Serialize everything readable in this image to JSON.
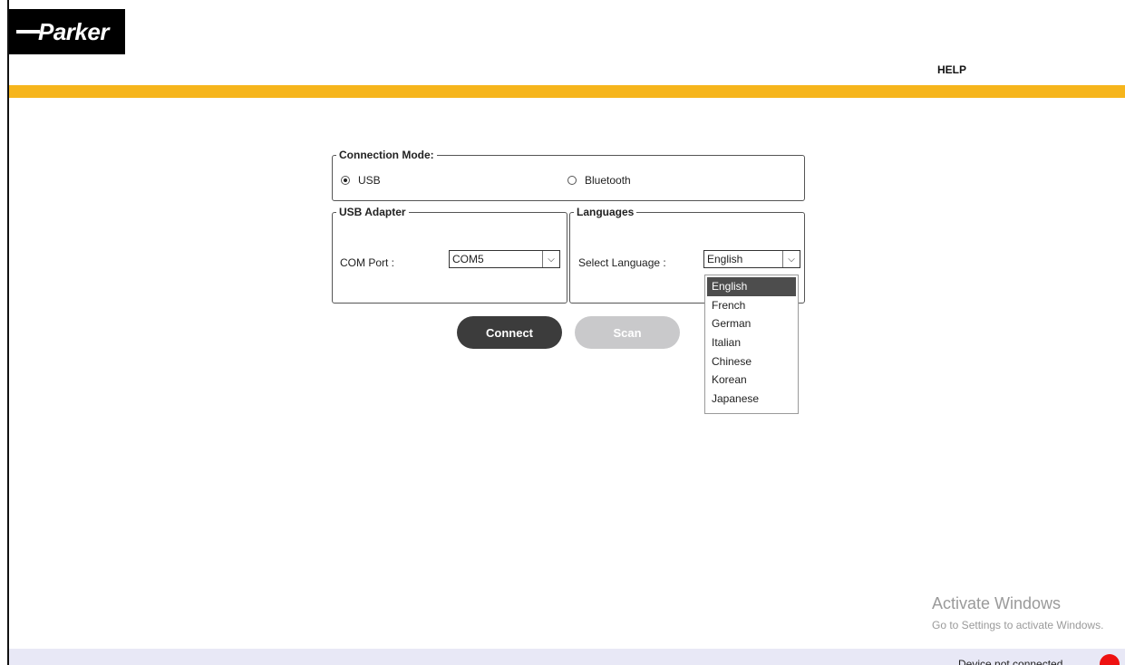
{
  "brand": {
    "logo_text": "Parker"
  },
  "header": {
    "help_label": "HELP"
  },
  "connection_mode": {
    "legend": "Connection Mode:",
    "options": [
      {
        "label": "USB",
        "selected": true
      },
      {
        "label": "Bluetooth",
        "selected": false
      }
    ]
  },
  "usb_adapter": {
    "legend": "USB Adapter",
    "com_port_label": "COM Port :",
    "com_port_value": "COM5"
  },
  "languages": {
    "legend": "Languages",
    "select_label": "Select Language :",
    "selected_value": "English",
    "options": [
      "English",
      "French",
      "German",
      "Italian",
      "Chinese",
      "Korean",
      "Japanese"
    ]
  },
  "actions": {
    "connect_label": "Connect",
    "scan_label": "Scan"
  },
  "watermark": {
    "title": "Activate Windows",
    "subtitle": "Go to Settings to activate Windows."
  },
  "status": {
    "text": "Device not connected",
    "indicator_color": "#ee1111"
  },
  "colors": {
    "accent": "#f6b51c",
    "button_dark": "#3c3c3c",
    "button_disabled": "#c9c9cb"
  }
}
